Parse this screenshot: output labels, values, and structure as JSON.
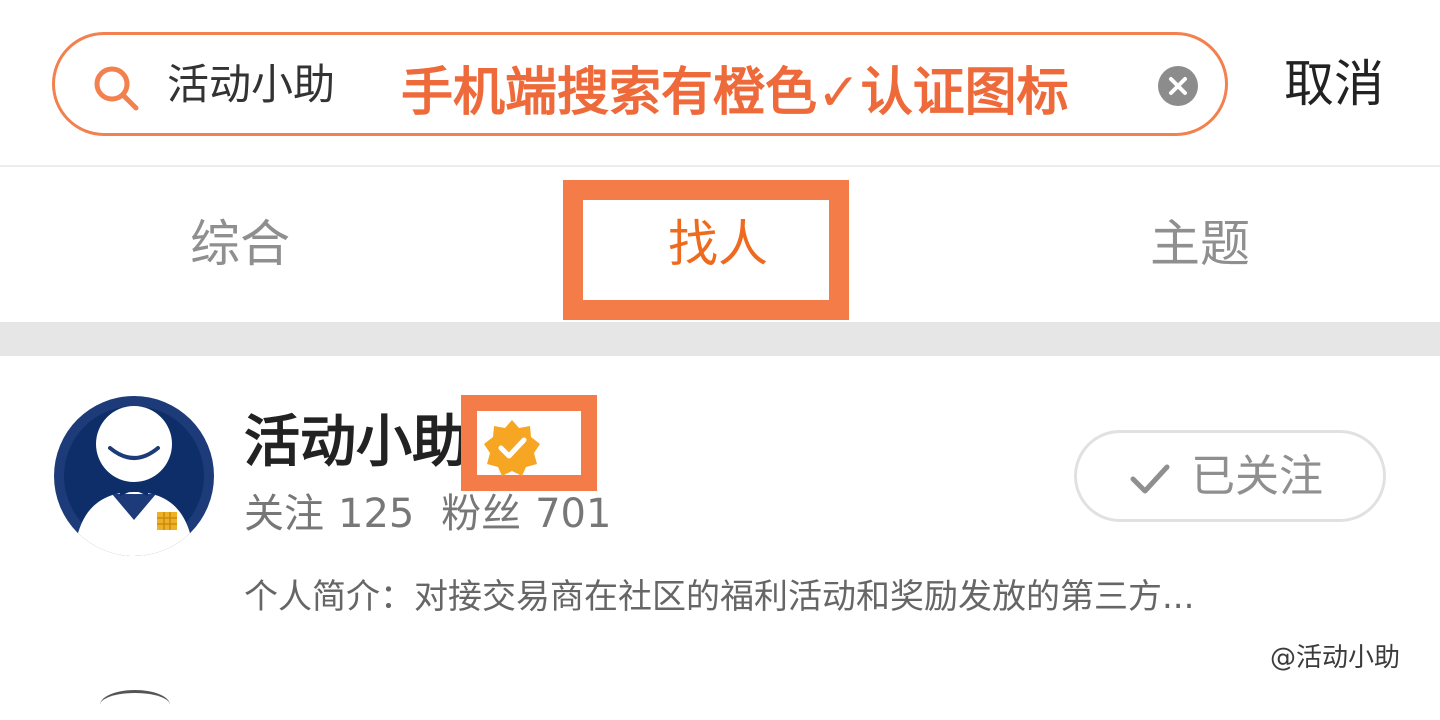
{
  "search": {
    "query": "活动小助",
    "annotation": "手机端搜索有橙色✓认证图标",
    "cancel_label": "取消",
    "icons": {
      "search": "search-icon",
      "clear": "clear-icon"
    }
  },
  "tabs": [
    {
      "label": "综合",
      "active": false
    },
    {
      "label": "找人",
      "active": true
    },
    {
      "label": "主题",
      "active": false
    }
  ],
  "result": {
    "name": "活动小助",
    "verified_icon": "verified-badge-icon",
    "stats": {
      "following_label": "关注",
      "following_count": "125",
      "followers_label": "粉丝",
      "followers_count": "701"
    },
    "bio": "个人简介：对接交易商在社区的福利活动和奖励发放的第三方...",
    "follow_label": "已关注"
  },
  "watermark": "@活动小助",
  "colors": {
    "accent": "#f47c48",
    "active_tab": "#ee6a1f",
    "annotation_text": "#ee6a3a",
    "verified_badge": "#f6a623"
  }
}
